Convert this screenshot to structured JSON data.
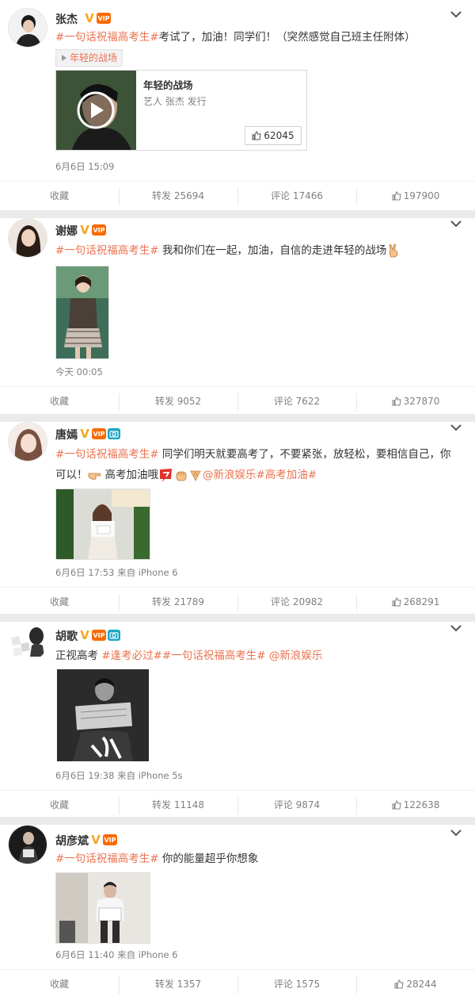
{
  "posts": [
    {
      "user": "张杰",
      "verified_badge": "V",
      "vip_badge": "VIP",
      "text_topic": "#一句话祝福高考生#",
      "text_body": "考试了，加油！同学们！（突然感觉自己班主任附体）",
      "music_tag": "年轻的战场",
      "card_title": "年轻的战场",
      "card_sub": "艺人 张杰 发行",
      "card_likes": "62045",
      "time": "6月6日 15:09",
      "collect_label": "收藏",
      "repost_label": "转发 25694",
      "comment_label": "评论 17466",
      "like_label": "197900"
    },
    {
      "user": "谢娜",
      "verified_badge": "V",
      "vip_badge": "VIP",
      "text_topic": "#一句话祝福高考生#",
      "text_body": " 我和你们在一起，加油，自信的走进年轻的战场",
      "time": "今天 00:05",
      "collect_label": "收藏",
      "repost_label": "转发 9052",
      "comment_label": "评论 7622",
      "like_label": "327870"
    },
    {
      "user": "唐嫣",
      "verified_badge": "V",
      "vip_badge": "VIP",
      "text_topic": "#一句话祝福高考生#",
      "text_body": " 同学们明天就要高考了，不要紧张，放轻松，要相信自己，你",
      "text_body2": "可以！",
      "text_body3": "高考加油哦",
      "at_user": "@新浪娱乐",
      "text_topic2": "#高考加油#",
      "time": "6月6日 17:53 来自 iPhone 6",
      "collect_label": "收藏",
      "repost_label": "转发 21789",
      "comment_label": "评论 20982",
      "like_label": "268291"
    },
    {
      "user": "胡歌",
      "verified_badge": "V",
      "vip_badge": "VIP",
      "text_prefix": "正视高考 ",
      "text_topic": "#逢考必过##一句话祝福高考生#",
      "at_user": " @新浪娱乐",
      "time": "6月6日 19:38 来自 iPhone 5s",
      "collect_label": "收藏",
      "repost_label": "转发 11148",
      "comment_label": "评论 9874",
      "like_label": "122638"
    },
    {
      "user": "胡彦斌",
      "verified_badge": "V",
      "vip_badge": "VIP",
      "text_topic": "#一句话祝福高考生#",
      "text_body": " 你的能量超乎你想象",
      "time": "6月6日 11:40 来自 iPhone 6",
      "collect_label": "收藏",
      "repost_label": "转发 1357",
      "comment_label": "评论 1575",
      "like_label": "28244"
    }
  ],
  "colors": {
    "topic": "#eb7350",
    "muted": "#808080",
    "separator": "#eaeaea"
  }
}
